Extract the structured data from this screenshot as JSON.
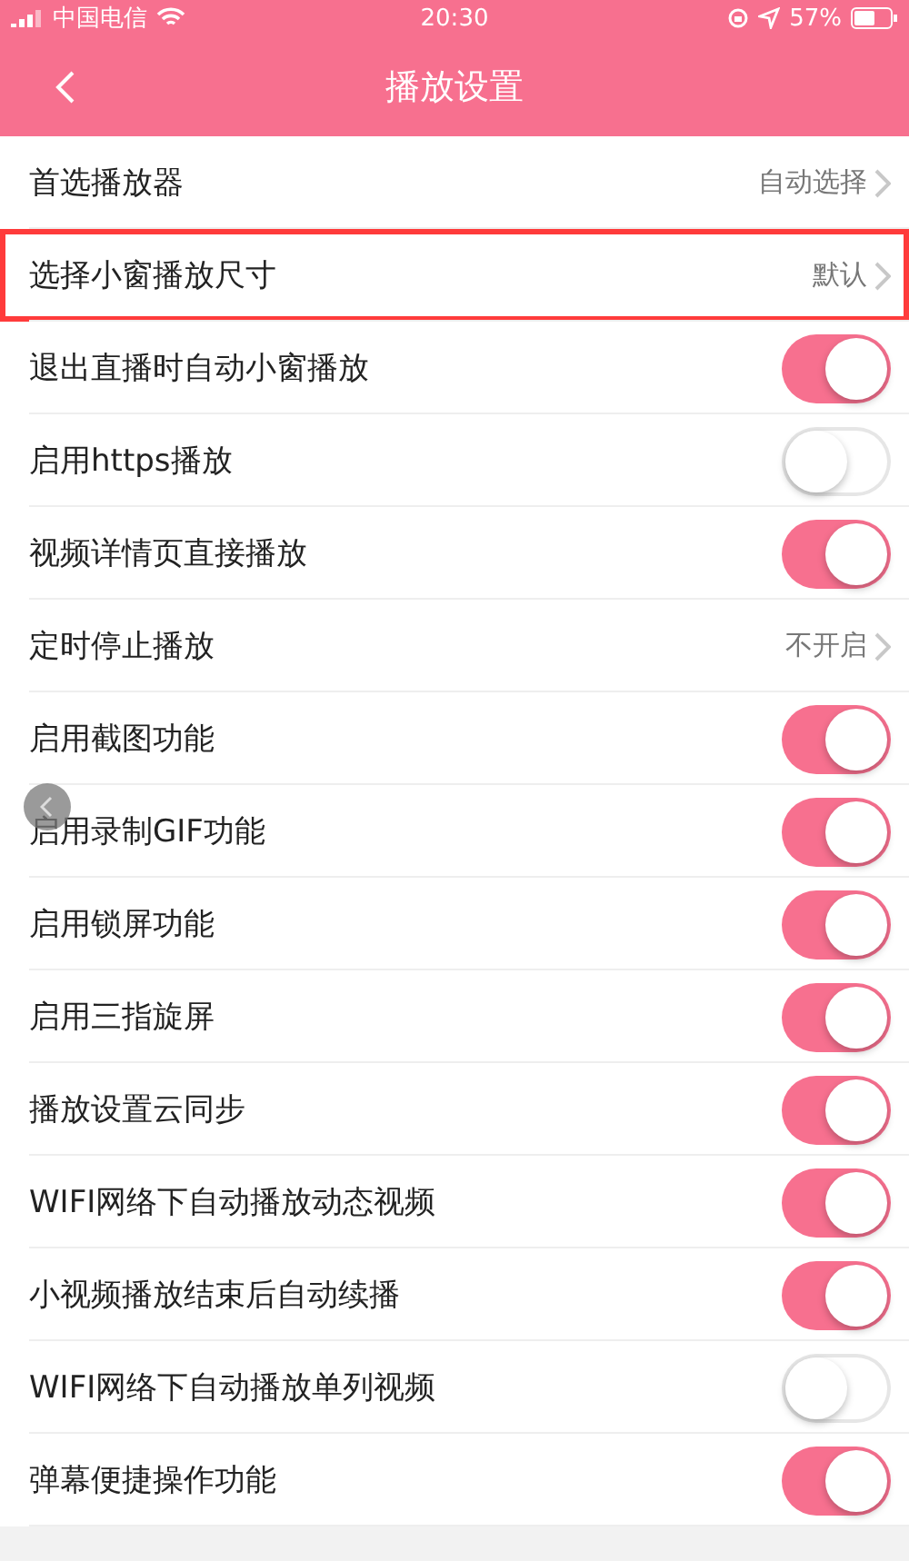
{
  "status_bar": {
    "carrier": "中国电信",
    "time": "20:30",
    "battery": "57%"
  },
  "nav": {
    "title": "播放设置"
  },
  "items": [
    {
      "kind": "link",
      "label": "首选播放器",
      "value": "自动选择",
      "highlighted": false
    },
    {
      "kind": "link",
      "label": "选择小窗播放尺寸",
      "value": "默认",
      "highlighted": true
    },
    {
      "kind": "toggle",
      "label": "退出直播时自动小窗播放",
      "on": true,
      "highlighted": false
    },
    {
      "kind": "toggle",
      "label": "启用https播放",
      "on": false,
      "highlighted": false
    },
    {
      "kind": "toggle",
      "label": "视频详情页直接播放",
      "on": true,
      "highlighted": false
    },
    {
      "kind": "link",
      "label": "定时停止播放",
      "value": "不开启",
      "highlighted": false
    },
    {
      "kind": "toggle",
      "label": "启用截图功能",
      "on": true,
      "highlighted": false
    },
    {
      "kind": "toggle",
      "label": "启用录制GIF功能",
      "on": true,
      "highlighted": false
    },
    {
      "kind": "toggle",
      "label": "启用锁屏功能",
      "on": true,
      "highlighted": false
    },
    {
      "kind": "toggle",
      "label": "启用三指旋屏",
      "on": true,
      "highlighted": false
    },
    {
      "kind": "toggle",
      "label": "播放设置云同步",
      "on": true,
      "highlighted": false
    },
    {
      "kind": "toggle",
      "label": "WIFI网络下自动播放动态视频",
      "on": true,
      "highlighted": false
    },
    {
      "kind": "toggle",
      "label": "小视频播放结束后自动续播",
      "on": true,
      "highlighted": false
    },
    {
      "kind": "toggle",
      "label": "WIFI网络下自动播放单列视频",
      "on": false,
      "highlighted": false
    },
    {
      "kind": "toggle",
      "label": "弹幕便捷操作功能",
      "on": true,
      "highlighted": false
    }
  ]
}
